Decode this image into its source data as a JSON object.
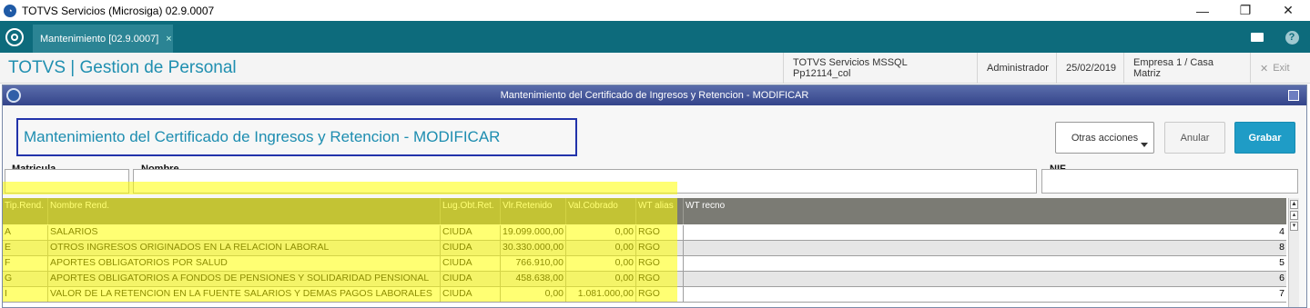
{
  "window": {
    "title": "TOTVS Servicios (Microsiga) 02.9.0007",
    "app_icon": "totvs-logo-icon",
    "controls": [
      "minimize-icon",
      "restore-icon",
      "close-icon"
    ]
  },
  "tabbar": {
    "tab_label": "Mantenimiento [02.9.0007]",
    "tab_close": "×",
    "icons": [
      "totvs-menu-icon",
      "mail-icon",
      "help-icon"
    ]
  },
  "header": {
    "product": "TOTVS | Gestion de Personal",
    "environment": "TOTVS Servicios MSSQL Pp12114_col",
    "user": "Administrador",
    "date": "25/02/2019",
    "company": "Empresa 1 / Casa Matriz",
    "exit": "Exit"
  },
  "dialog": {
    "title": "Mantenimiento del Certificado de Ingresos y Retencion - MODIFICAR",
    "heading": "Mantenimiento del Certificado de Ingresos y Retencion - MODIFICAR",
    "buttons": {
      "more": "Otras acciones",
      "cancel": "Anular",
      "save": "Grabar"
    },
    "fields": {
      "matricula_label": "Matricula",
      "nombre_label": "Nombre",
      "nif_label": "NIF",
      "matricula_value": "",
      "nombre_value": "",
      "nif_value": ""
    }
  },
  "grid": {
    "columns": [
      "Tip.Rend.",
      "Nombre Rend.",
      "Lug.Obt.Ret.",
      "Vlr.Retenido",
      "Val.Cobrado",
      "WT alias",
      "WT recno"
    ],
    "rows": [
      {
        "tip": "A",
        "nombre": "SALARIOS",
        "lug": "CIUDA",
        "retenido": "19.099.000,00",
        "cobrado": "0,00",
        "alias": "RGO",
        "recno": "4"
      },
      {
        "tip": "E",
        "nombre": "OTROS INGRESOS ORIGINADOS EN LA RELACION LABORAL",
        "lug": "CIUDA",
        "retenido": "30.330.000,00",
        "cobrado": "0,00",
        "alias": "RGO",
        "recno": "8"
      },
      {
        "tip": "F",
        "nombre": "APORTES OBLIGATORIOS POR SALUD",
        "lug": "CIUDA",
        "retenido": "766.910,00",
        "cobrado": "0,00",
        "alias": "RGO",
        "recno": "5"
      },
      {
        "tip": "G",
        "nombre": "APORTES OBLIGATORIOS A FONDOS DE PENSIONES Y SOLIDARIDAD PENSIONAL",
        "lug": "CIUDA",
        "retenido": "458.638,00",
        "cobrado": "0,00",
        "alias": "RGO",
        "recno": "6"
      },
      {
        "tip": "I",
        "nombre": "VALOR DE LA RETENCION EN LA FUENTE SALARIOS Y DEMAS PAGOS LABORALES",
        "lug": "CIUDA",
        "retenido": "0,00",
        "cobrado": "1.081.000,00",
        "alias": "RGO",
        "recno": "7"
      }
    ]
  },
  "colors": {
    "teal": "#0d6b7c",
    "accent_blue": "#1f9cc6",
    "highlight": "#ffff00",
    "dialog_title": "#34448a"
  }
}
